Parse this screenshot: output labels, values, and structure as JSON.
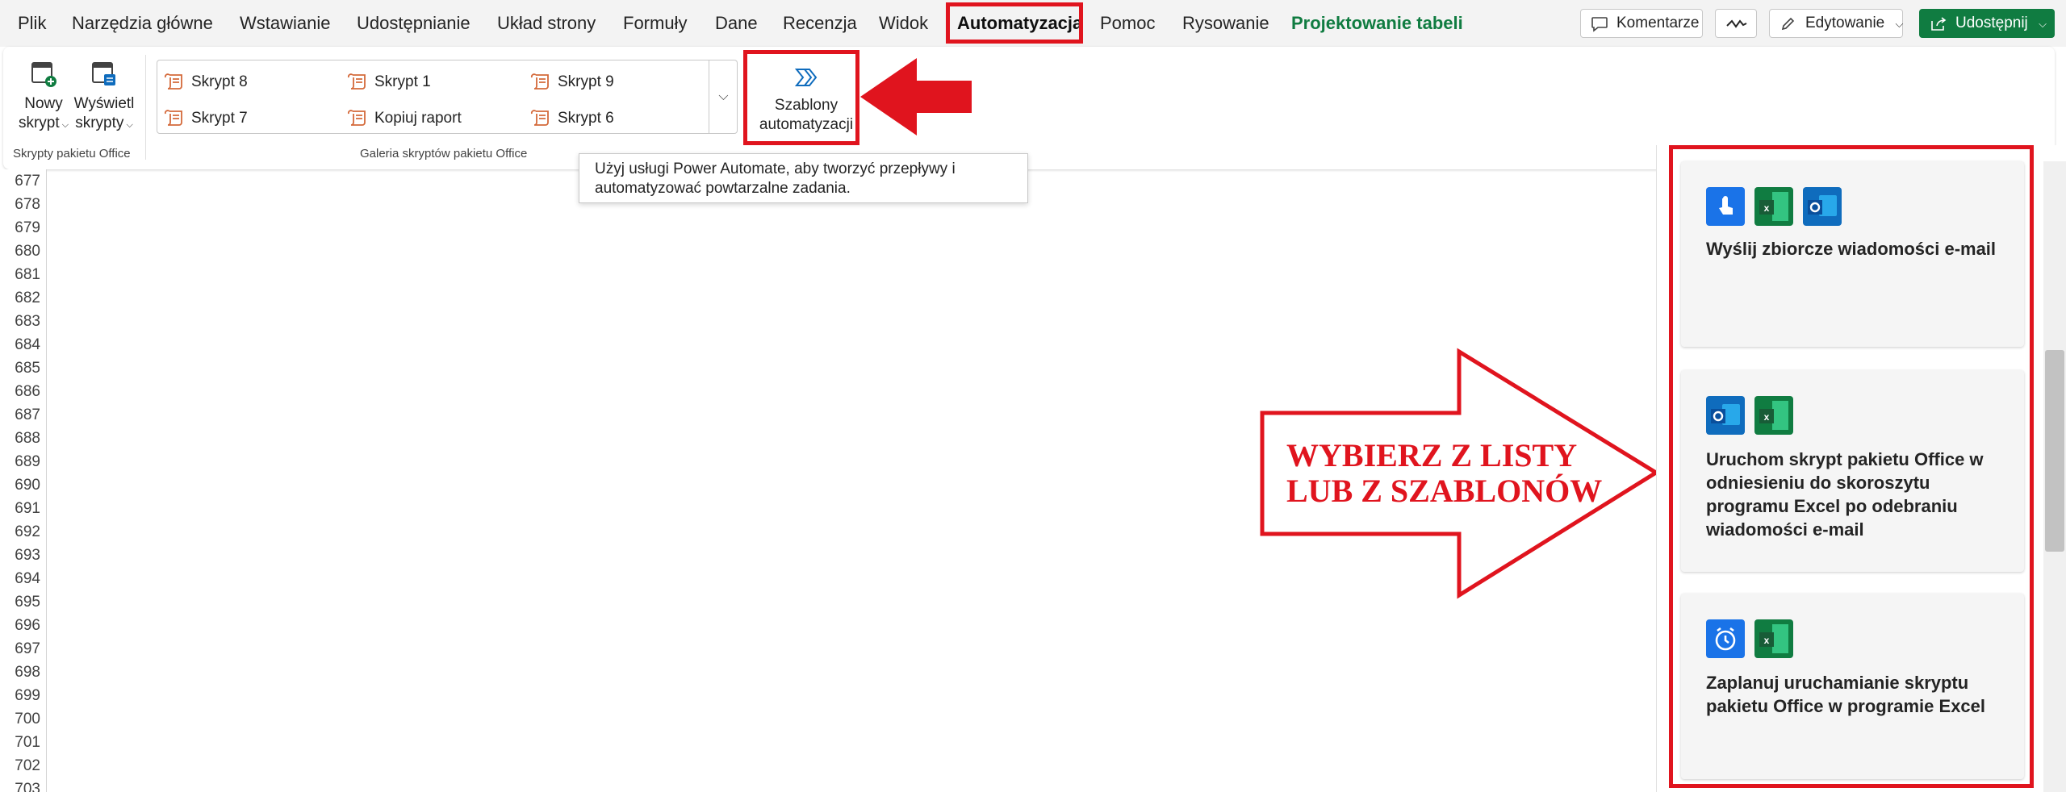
{
  "menu": {
    "tabs": [
      "Plik",
      "Narzędzia główne",
      "Wstawianie",
      "Udostępnianie",
      "Układ strony",
      "Formuły",
      "Dane",
      "Recenzja",
      "Widok",
      "Automatyzacja",
      "Pomoc",
      "Rysowanie",
      "Projektowanie tabeli"
    ],
    "active_tab": "Automatyzacja"
  },
  "top_buttons": {
    "comments": "Komentarze",
    "editing": "Edytowanie",
    "share": "Udostępnij"
  },
  "ribbon": {
    "new_script_line1": "Nowy",
    "new_script_line2": "skrypt",
    "view_scripts_line1": "Wyświetl",
    "view_scripts_line2": "skrypty",
    "group_office_scripts": "Skrypty pakietu Office",
    "gallery_items": [
      "Skrypt 8",
      "Skrypt 1",
      "Skrypt 9",
      "Skrypt 7",
      "Kopiuj raport",
      "Skrypt 6"
    ],
    "group_gallery": "Galeria skryptów pakietu Office",
    "templates_line1": "Szablony",
    "templates_line2": "automatyzacji"
  },
  "tooltip": {
    "line1": "Użyj usługi Power Automate, aby tworzyć przepływy i",
    "line2": "automatyzować powtarzalne zadania."
  },
  "rows": [
    "677",
    "678",
    "679",
    "680",
    "681",
    "682",
    "683",
    "684",
    "685",
    "686",
    "687",
    "688",
    "689",
    "690",
    "691",
    "692",
    "693",
    "694",
    "695",
    "696",
    "697",
    "698",
    "699",
    "700",
    "701",
    "702",
    "703"
  ],
  "annotation": {
    "line1": "WYBIERZ Z LISTY",
    "line2": "LUB Z SZABLONÓW"
  },
  "templates": [
    {
      "title": "Wyślij zbiorcze wiadomości e-mail"
    },
    {
      "title": "Uruchom skrypt pakietu Office w odniesieniu do skoroszytu programu Excel po odebraniu wiadomości e-mail"
    },
    {
      "title": "Zaplanuj uruchamianie skryptu pakietu Office w programie Excel"
    }
  ],
  "colors": {
    "excel_green": "#107c41",
    "highlight_red": "#e0141e",
    "script_icon": "#d4693a",
    "power_automate_blue": "#0f6cbd"
  }
}
